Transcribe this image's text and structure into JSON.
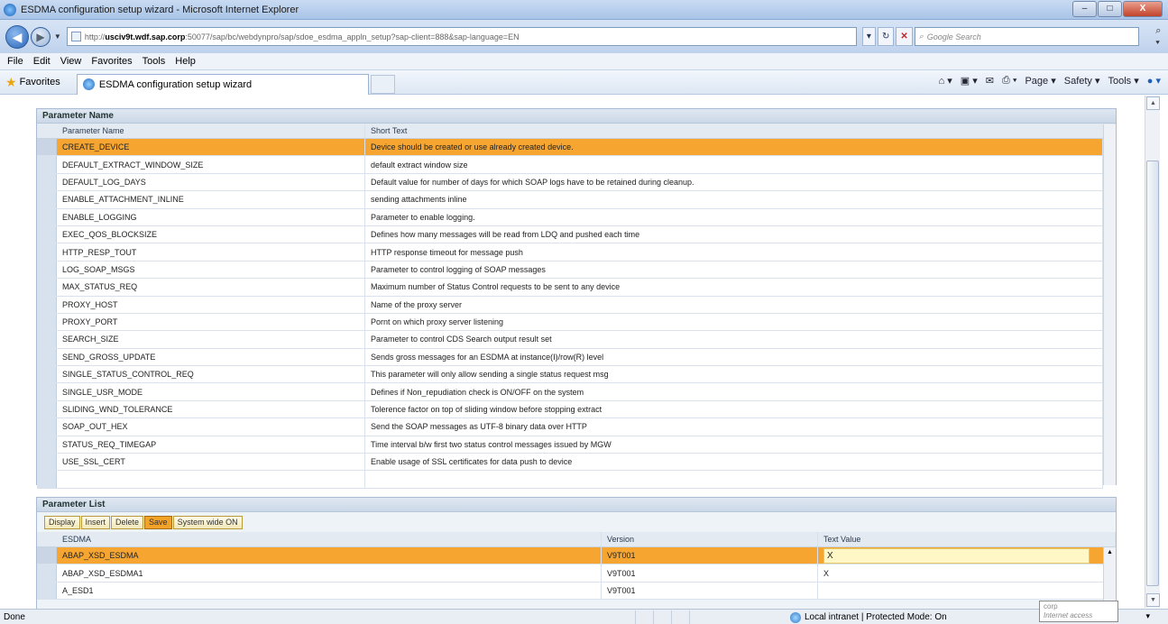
{
  "window": {
    "title": "ESDMA configuration setup wizard - Microsoft Internet Explorer",
    "minimize": "–",
    "maximize": "□",
    "close": "X"
  },
  "address": {
    "url_prefix": "http://",
    "url_host": "usciv9t.wdf.sap.corp",
    "url_rest": ":50077/sap/bc/webdynpro/sap/sdoe_esdma_appln_setup?sap-client=888&sap-language=EN",
    "search_placeholder": "Google Search"
  },
  "menu": [
    "File",
    "Edit",
    "View",
    "Favorites",
    "Tools",
    "Help"
  ],
  "favorites": {
    "label": "Favorites",
    "tab_title": "ESDMA configuration setup wizard",
    "commands": [
      "Page ▾",
      "Safety ▾",
      "Tools ▾"
    ]
  },
  "parameter_name_panel": {
    "title": "Parameter Name",
    "columns": [
      "Parameter Name",
      "Short Text"
    ],
    "rows": [
      {
        "name": "CREATE_DEVICE",
        "text": "Device should be created or use already created device."
      },
      {
        "name": "DEFAULT_EXTRACT_WINDOW_SIZE",
        "text": "default extract window size"
      },
      {
        "name": "DEFAULT_LOG_DAYS",
        "text": "Default value for number of days for which SOAP logs have to be retained during cleanup."
      },
      {
        "name": "ENABLE_ATTACHMENT_INLINE",
        "text": "sending attachments inline"
      },
      {
        "name": "ENABLE_LOGGING",
        "text": "Parameter to enable logging."
      },
      {
        "name": "EXEC_QOS_BLOCKSIZE",
        "text": "Defines how many messages will be read from LDQ and pushed each time"
      },
      {
        "name": "HTTP_RESP_TOUT",
        "text": "HTTP response timeout for message push"
      },
      {
        "name": "LOG_SOAP_MSGS",
        "text": "Parameter to control logging of SOAP messages"
      },
      {
        "name": "MAX_STATUS_REQ",
        "text": "Maximum number of Status Control requests to be sent to any device"
      },
      {
        "name": "PROXY_HOST",
        "text": "Name of the proxy server"
      },
      {
        "name": "PROXY_PORT",
        "text": "Pornt on which proxy server listening"
      },
      {
        "name": "SEARCH_SIZE",
        "text": "Parameter to control CDS Search output result set"
      },
      {
        "name": "SEND_GROSS_UPDATE",
        "text": "Sends gross messages for an ESDMA at instance(I)/row(R) level"
      },
      {
        "name": "SINGLE_STATUS_CONTROL_REQ",
        "text": "This parameter will only allow sending a single status request msg"
      },
      {
        "name": "SINGLE_USR_MODE",
        "text": "Defines if Non_repudiation check is ON/OFF on the system"
      },
      {
        "name": "SLIDING_WND_TOLERANCE",
        "text": "Tolerence factor on top of sliding window before stopping extract"
      },
      {
        "name": "SOAP_OUT_HEX",
        "text": "Send the SOAP messages as UTF-8 binary data over HTTP"
      },
      {
        "name": "STATUS_REQ_TIMEGAP",
        "text": "Time interval b/w first two status control messages issued by MGW"
      },
      {
        "name": "USE_SSL_CERT",
        "text": "Enable usage of SSL certificates for data push to device"
      },
      {
        "name": "",
        "text": ""
      }
    ]
  },
  "parameter_list_panel": {
    "title": "Parameter List",
    "buttons": [
      "Display",
      "Insert",
      "Delete",
      "Save",
      "System wide ON"
    ],
    "columns": [
      "ESDMA",
      "Version",
      "Text Value"
    ],
    "rows": [
      {
        "esdma": "ABAP_XSD_ESDMA",
        "version": "V9T001",
        "value": "X"
      },
      {
        "esdma": "ABAP_XSD_ESDMA1",
        "version": "V9T001",
        "value": "X"
      },
      {
        "esdma": "A_ESD1",
        "version": "V9T001",
        "value": ""
      }
    ]
  },
  "status": {
    "left": "Done",
    "zone": "Local intranet | Protected Mode: On",
    "tooltip_line1": "corp",
    "tooltip_line2": "Internet access"
  }
}
